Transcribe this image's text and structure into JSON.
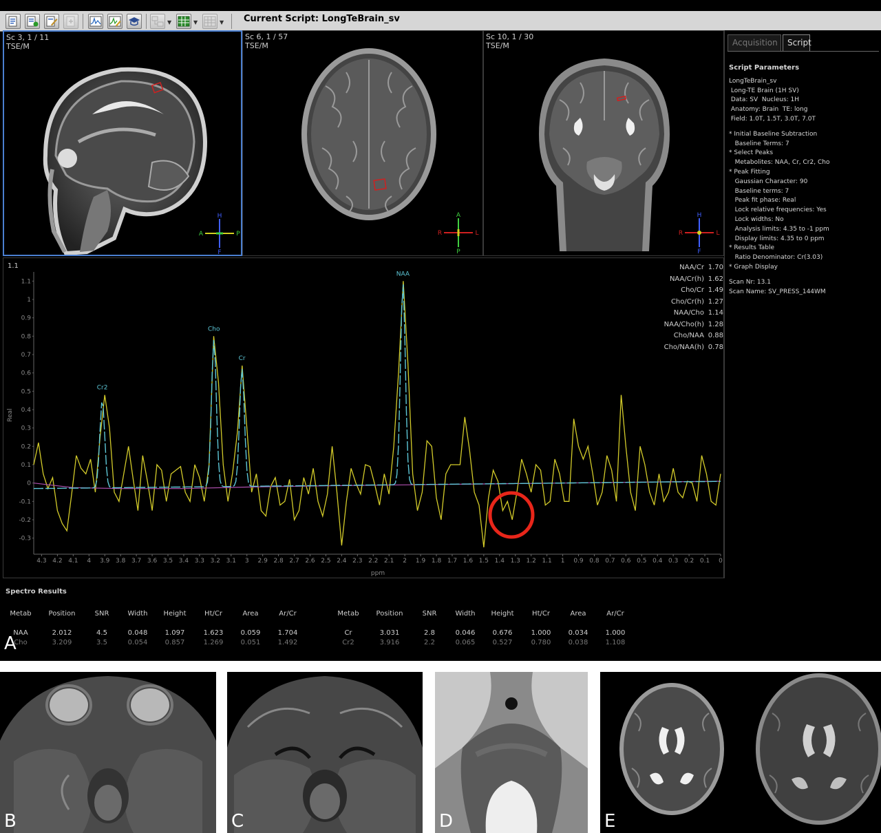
{
  "toolbar": {
    "script_title": "Current Script: LongTeBrain_sv",
    "icons": [
      "script-open-icon",
      "script-run-icon",
      "script-edit-icon",
      "script-disabled-icon",
      "spectrum-view-icon",
      "spectrum-edit-icon",
      "graduation-cap-icon",
      "layout-tree-icon",
      "grid-layout-icon",
      "grid-dim-icon"
    ]
  },
  "viewports": [
    {
      "line1": "Sc 3, 1 / 11",
      "line2": "TSE/M",
      "orientation": {
        "top": "H",
        "bottom": "F",
        "left": "A",
        "right": "P"
      }
    },
    {
      "line1": "Sc 6, 1 / 57",
      "line2": "TSE/M",
      "orientation": {
        "top": "A",
        "bottom": "P",
        "left": "R",
        "right": "L"
      }
    },
    {
      "line1": "Sc 10, 1 / 30",
      "line2": "TSE/M",
      "orientation": {
        "top": "H",
        "bottom": "F",
        "left": "R",
        "right": "L"
      }
    }
  ],
  "side_panel": {
    "tabs": [
      "Acquisition",
      "Script"
    ],
    "heading": "Script Parameters",
    "lines_a": [
      "LongTeBrain_sv",
      " Long-TE Brain (1H SV)",
      " Data: SV  Nucleus: 1H",
      " Anatomy: Brain  TE: long",
      " Field: 1.0T, 1.5T, 3.0T, 7.0T"
    ],
    "lines_b": [
      "* Initial Baseline Subtraction",
      "   Baseline Terms: 7",
      "* Select Peaks",
      "   Metabolites: NAA, Cr, Cr2, Cho",
      "* Peak Fitting",
      "   Gaussian Character: 90",
      "   Baseline terms: 7",
      "   Peak fit phase: Real",
      "   Lock relative frequencies: Yes",
      "   Lock widths: No",
      "   Analysis limits: 4.35 to -1 ppm",
      "   Display limits: 4.35 to 0 ppm",
      "* Results Table",
      "   Ratio Denominator: Cr(3.03)",
      "* Graph Display"
    ],
    "lines_c": [
      "Scan Nr: 13.1",
      "Scan Name: SV_PRESS_144WM"
    ]
  },
  "spectrum_panel": {
    "label": "1.1",
    "ylabel": "Real",
    "xlabel": "ppm",
    "ratios": [
      {
        "name": "NAA/Cr",
        "value": "1.70"
      },
      {
        "name": "NAA/Cr(h)",
        "value": "1.62"
      },
      {
        "name": "Cho/Cr",
        "value": "1.49"
      },
      {
        "name": "Cho/Cr(h)",
        "value": "1.27"
      },
      {
        "name": "NAA/Cho",
        "value": "1.14"
      },
      {
        "name": "NAA/Cho(h)",
        "value": "1.28"
      },
      {
        "name": "Cho/NAA",
        "value": "0.88"
      },
      {
        "name": "Cho/NAA(h)",
        "value": "0.78"
      }
    ]
  },
  "chart_data": {
    "type": "line",
    "xlabel": "ppm",
    "ylabel": "Real",
    "xlim": [
      4.35,
      0
    ],
    "ylim": [
      -0.35,
      1.15
    ],
    "yticks": [
      -0.3,
      -0.2,
      -0.1,
      0,
      0.1,
      0.2,
      0.3,
      0.4,
      0.5,
      0.6,
      0.7,
      0.8,
      0.9,
      1,
      1.1
    ],
    "xticks": [
      4.3,
      4.2,
      4.1,
      4,
      3.9,
      3.8,
      3.7,
      3.6,
      3.5,
      3.4,
      3.3,
      3.2,
      3.1,
      3,
      2.9,
      2.8,
      2.7,
      2.6,
      2.5,
      2.4,
      2.3,
      2.2,
      2.1,
      2,
      1.9,
      1.8,
      1.7,
      1.6,
      1.5,
      1.4,
      1.3,
      1.2,
      1.1,
      1,
      0.9,
      0.8,
      0.7,
      0.6,
      0.5,
      0.4,
      0.3,
      0.2,
      0.1,
      0
    ],
    "peaks": [
      {
        "label": "Cr2",
        "ppm": 3.916,
        "height": 0.48
      },
      {
        "label": "Cho",
        "ppm": 3.209,
        "height": 0.8
      },
      {
        "label": "Cr",
        "ppm": 3.031,
        "height": 0.64
      },
      {
        "label": "NAA",
        "ppm": 2.012,
        "height": 1.1
      }
    ],
    "series": [
      {
        "name": "",
        "color": "#d4cc2a",
        "points": [
          [
            4.35,
            0.1
          ],
          [
            4.32,
            0.22
          ],
          [
            4.29,
            0.05
          ],
          [
            4.26,
            -0.03
          ],
          [
            4.23,
            0.03
          ],
          [
            4.2,
            -0.15
          ],
          [
            4.17,
            -0.22
          ],
          [
            4.14,
            -0.26
          ],
          [
            4.11,
            -0.06
          ],
          [
            4.08,
            0.15
          ],
          [
            4.05,
            0.08
          ],
          [
            4.02,
            0.05
          ],
          [
            3.99,
            0.13
          ],
          [
            3.96,
            -0.05
          ],
          [
            3.93,
            0.25
          ],
          [
            3.9,
            0.48
          ],
          [
            3.87,
            0.3
          ],
          [
            3.84,
            -0.05
          ],
          [
            3.81,
            -0.1
          ],
          [
            3.78,
            0.05
          ],
          [
            3.75,
            0.2
          ],
          [
            3.72,
            0.02
          ],
          [
            3.69,
            -0.15
          ],
          [
            3.66,
            0.15
          ],
          [
            3.63,
            0.01
          ],
          [
            3.6,
            -0.15
          ],
          [
            3.57,
            0.1
          ],
          [
            3.54,
            0.07
          ],
          [
            3.51,
            -0.1
          ],
          [
            3.48,
            0.05
          ],
          [
            3.45,
            0.07
          ],
          [
            3.42,
            0.09
          ],
          [
            3.39,
            -0.05
          ],
          [
            3.36,
            -0.1
          ],
          [
            3.33,
            0.1
          ],
          [
            3.3,
            0.03
          ],
          [
            3.27,
            -0.1
          ],
          [
            3.24,
            0.1
          ],
          [
            3.21,
            0.8
          ],
          [
            3.18,
            0.55
          ],
          [
            3.15,
            0.1
          ],
          [
            3.12,
            -0.1
          ],
          [
            3.09,
            0.06
          ],
          [
            3.06,
            0.28
          ],
          [
            3.03,
            0.64
          ],
          [
            3.0,
            0.3
          ],
          [
            2.97,
            -0.05
          ],
          [
            2.94,
            0.05
          ],
          [
            2.91,
            -0.15
          ],
          [
            2.88,
            -0.18
          ],
          [
            2.85,
            -0.02
          ],
          [
            2.82,
            0.03
          ],
          [
            2.79,
            -0.12
          ],
          [
            2.76,
            -0.1
          ],
          [
            2.73,
            0.02
          ],
          [
            2.7,
            -0.2
          ],
          [
            2.67,
            -0.15
          ],
          [
            2.64,
            0.03
          ],
          [
            2.61,
            -0.06
          ],
          [
            2.58,
            0.08
          ],
          [
            2.55,
            -0.1
          ],
          [
            2.52,
            -0.18
          ],
          [
            2.49,
            -0.06
          ],
          [
            2.46,
            0.2
          ],
          [
            2.43,
            -0.05
          ],
          [
            2.4,
            -0.34
          ],
          [
            2.37,
            -0.1
          ],
          [
            2.34,
            0.08
          ],
          [
            2.31,
            0.0
          ],
          [
            2.28,
            -0.06
          ],
          [
            2.25,
            0.1
          ],
          [
            2.22,
            0.09
          ],
          [
            2.19,
            -0.01
          ],
          [
            2.16,
            -0.12
          ],
          [
            2.13,
            0.05
          ],
          [
            2.1,
            -0.06
          ],
          [
            2.07,
            0.2
          ],
          [
            2.04,
            0.6
          ],
          [
            2.01,
            1.1
          ],
          [
            1.98,
            0.65
          ],
          [
            1.95,
            0.05
          ],
          [
            1.92,
            -0.15
          ],
          [
            1.89,
            -0.05
          ],
          [
            1.86,
            0.23
          ],
          [
            1.83,
            0.2
          ],
          [
            1.8,
            -0.08
          ],
          [
            1.77,
            -0.2
          ],
          [
            1.74,
            0.05
          ],
          [
            1.71,
            0.1
          ],
          [
            1.68,
            0.1
          ],
          [
            1.65,
            0.1
          ],
          [
            1.62,
            0.36
          ],
          [
            1.59,
            0.18
          ],
          [
            1.56,
            -0.05
          ],
          [
            1.53,
            -0.12
          ],
          [
            1.5,
            -0.35
          ],
          [
            1.47,
            -0.08
          ],
          [
            1.44,
            0.07
          ],
          [
            1.41,
            0.01
          ],
          [
            1.38,
            -0.15
          ],
          [
            1.35,
            -0.1
          ],
          [
            1.32,
            -0.2
          ],
          [
            1.29,
            -0.05
          ],
          [
            1.26,
            0.13
          ],
          [
            1.23,
            0.05
          ],
          [
            1.2,
            -0.05
          ],
          [
            1.17,
            0.1
          ],
          [
            1.14,
            0.07
          ],
          [
            1.11,
            -0.12
          ],
          [
            1.08,
            -0.1
          ],
          [
            1.05,
            0.13
          ],
          [
            1.02,
            0.05
          ],
          [
            0.99,
            -0.1
          ],
          [
            0.96,
            -0.1
          ],
          [
            0.93,
            0.35
          ],
          [
            0.9,
            0.2
          ],
          [
            0.87,
            0.13
          ],
          [
            0.84,
            0.2
          ],
          [
            0.81,
            0.05
          ],
          [
            0.78,
            -0.12
          ],
          [
            0.75,
            -0.05
          ],
          [
            0.72,
            0.15
          ],
          [
            0.69,
            0.07
          ],
          [
            0.66,
            -0.1
          ],
          [
            0.63,
            0.48
          ],
          [
            0.6,
            0.2
          ],
          [
            0.57,
            -0.05
          ],
          [
            0.54,
            -0.15
          ],
          [
            0.51,
            0.2
          ],
          [
            0.48,
            0.1
          ],
          [
            0.45,
            -0.05
          ],
          [
            0.42,
            -0.12
          ],
          [
            0.39,
            0.05
          ],
          [
            0.36,
            -0.1
          ],
          [
            0.33,
            -0.05
          ],
          [
            0.3,
            0.08
          ],
          [
            0.27,
            -0.05
          ],
          [
            0.24,
            -0.08
          ],
          [
            0.21,
            0.01
          ],
          [
            0.18,
            0.0
          ],
          [
            0.15,
            -0.1
          ],
          [
            0.12,
            0.15
          ],
          [
            0.09,
            0.05
          ],
          [
            0.06,
            -0.1
          ],
          [
            0.03,
            -0.12
          ],
          [
            0.0,
            0.05
          ]
        ]
      },
      {
        "name": "",
        "color": "#5ec8d8",
        "points": []
      },
      {
        "name": "",
        "color": "#b050b0",
        "points": [
          [
            4.35,
            0.0
          ],
          [
            4.1,
            -0.025
          ],
          [
            3.8,
            -0.03
          ],
          [
            3.4,
            -0.03
          ],
          [
            3.0,
            -0.022
          ],
          [
            2.5,
            -0.015
          ],
          [
            2.0,
            -0.01
          ],
          [
            1.5,
            -0.005
          ],
          [
            1.0,
            0.0
          ],
          [
            0.5,
            0.005
          ],
          [
            0.0,
            0.01
          ]
        ]
      }
    ]
  },
  "results": {
    "title": "Spectro Results",
    "columns": [
      "Metab",
      "Position",
      "SNR",
      "Width",
      "Height",
      "Ht/Cr",
      "Area",
      "Ar/Cr"
    ],
    "left_rows": [
      [
        "NAA",
        "2.012",
        "4.5",
        "0.048",
        "1.097",
        "1.623",
        "0.059",
        "1.704"
      ],
      [
        "Cho",
        "3.209",
        "3.5",
        "0.054",
        "0.857",
        "1.269",
        "0.051",
        "1.492"
      ]
    ],
    "right_rows": [
      [
        "Cr",
        "3.031",
        "2.8",
        "0.046",
        "0.676",
        "1.000",
        "0.034",
        "1.000"
      ],
      [
        "Cr2",
        "3.916",
        "2.2",
        "0.065",
        "0.527",
        "0.780",
        "0.038",
        "1.108"
      ]
    ]
  },
  "figure_labels": {
    "a": "A",
    "b": "B",
    "c": "C",
    "d": "D",
    "e": "E"
  },
  "annotation_color": "#e8261a"
}
